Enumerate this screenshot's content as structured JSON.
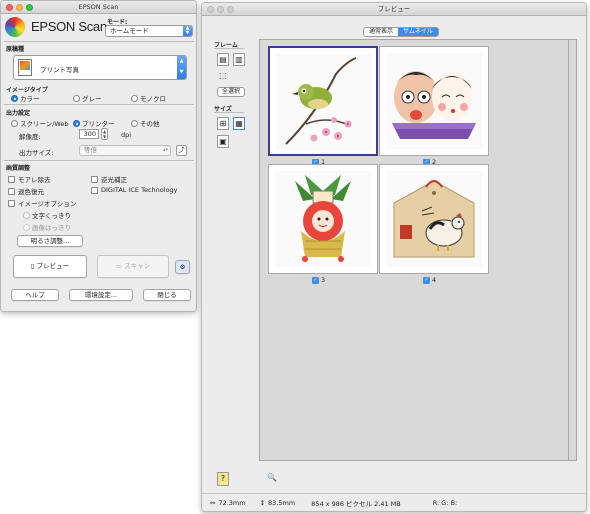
{
  "scan_window": {
    "title": "EPSON Scan",
    "logo_text": "EPSON Scan",
    "mode_label": "モード:",
    "mode_value": "ホームモード",
    "doc_type_label": "原稿種",
    "doc_type_value": "プリント写真",
    "image_type_label": "イメージタイプ",
    "image_types": [
      "カラー",
      "グレー",
      "モノクロ"
    ],
    "image_type_selected": "カラー",
    "output_label": "出力設定",
    "outputs": [
      "スクリーン/Web",
      "プリンター",
      "その他"
    ],
    "output_selected": "プリンター",
    "resolution_label": "解像度:",
    "resolution_value": "300",
    "resolution_unit": "dpi",
    "output_size_label": "出力サイズ:",
    "output_size_value": "等倍",
    "adjust_label": "画質調整",
    "checks": [
      "モアレ除去",
      "逆光補正",
      "退色復元",
      "DIGITAL ICE Technology",
      "イメージオプション"
    ],
    "sub_options": [
      "文字くっきり",
      "画像はっきり"
    ],
    "brightness_button": "明るさ調整...",
    "preview_button": "プレビュー",
    "scan_button": "スキャン",
    "help_button": "ヘルプ",
    "settings_button": "環境設定...",
    "close_button": "閉じる"
  },
  "preview_window": {
    "title": "プレビュー",
    "tabs": [
      "通常表示",
      "サムネイル"
    ],
    "active_tab": "サムネイル",
    "frame_label": "フレーム",
    "select_all": "全選択",
    "size_label": "サイズ",
    "thumbnails": [
      {
        "label": "1",
        "checked": true,
        "selected": true
      },
      {
        "label": "2",
        "checked": true,
        "selected": false
      },
      {
        "label": "3",
        "checked": true,
        "selected": false
      },
      {
        "label": "4",
        "checked": true,
        "selected": false
      }
    ],
    "status": {
      "width": "72.3mm",
      "height": "83.5mm",
      "pixels": "854 x 986 ピクセル 2.41 MB",
      "rgb": "R: G: B:"
    }
  },
  "colors": {
    "accent": "#3d8cf0",
    "window_bg": "#ececec",
    "thumb_area_bg": "#d9d9d9"
  }
}
